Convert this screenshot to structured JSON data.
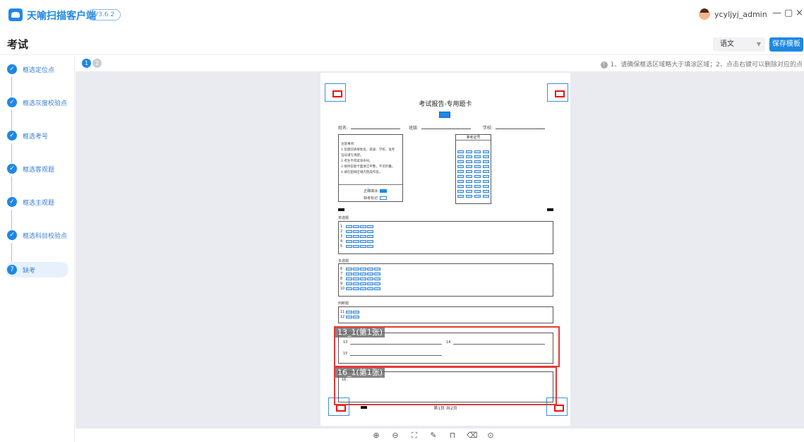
{
  "app": {
    "name": "天喻扫描客户端",
    "version": "V3.6.2"
  },
  "user": {
    "name": "ycyljyj_admin"
  },
  "window": {
    "minimize": "—",
    "maximize": "▢",
    "close": "×"
  },
  "page": {
    "title": "考试",
    "subject_select": "语文",
    "save_button": "保存模板"
  },
  "steps": [
    {
      "label": "框选定位点",
      "state": "done",
      "icon": "✓"
    },
    {
      "label": "框选灰度校验点",
      "state": "done",
      "icon": "✓"
    },
    {
      "label": "框选考号",
      "state": "done",
      "icon": "✓"
    },
    {
      "label": "框选客观题",
      "state": "done",
      "icon": "✓"
    },
    {
      "label": "框选主观题",
      "state": "done",
      "icon": "✓"
    },
    {
      "label": "框选科目校验点",
      "state": "done",
      "icon": "✓"
    },
    {
      "label": "缺考",
      "state": "active",
      "icon": "7"
    }
  ],
  "pages": [
    "1",
    "2"
  ],
  "hint": "1、请确保框选区域略大于填涂区域；2、点击右键可以删除对应的点",
  "sheet": {
    "title": "考试报告-专用题卡",
    "fields": [
      "姓名:",
      "班级:",
      "学校:"
    ],
    "notes_lines": [
      "注意事项:",
      "1.答题前请将姓名、班级、学校、准考",
      "证号填写清楚。",
      "2.考生不得遮涂条码。",
      "3.保持答题卡面清洁平整，不可折叠。",
      "4.请在题目区域内完成作答。"
    ],
    "fill_example": "正确填涂",
    "absent_mark": "缺考标记",
    "id_header": "准考证号",
    "section_single": "单选题",
    "section_multi": "多选题",
    "section_judge": "判断题",
    "q_nums_single": [
      "1",
      "2",
      "3",
      "4",
      "5"
    ],
    "q_nums_multi": [
      "6",
      "7",
      "8",
      "9",
      "10"
    ],
    "q_nums_judge": [
      "11",
      "12"
    ],
    "fill_q13": "13",
    "fill_q14": "14",
    "fill_q15": "15",
    "fill_q16": "16 .",
    "region_1": "13_1(第1张)",
    "region_2": "16_1(第1张)",
    "footer": "第1页 共2页"
  },
  "toolbar": [
    {
      "name": "zoom-in-icon",
      "glyph": "⊕"
    },
    {
      "name": "zoom-out-icon",
      "glyph": "⊖"
    },
    {
      "name": "fit-screen-icon",
      "glyph": "⛶"
    },
    {
      "name": "edit-region-icon",
      "glyph": "✎"
    },
    {
      "name": "select-region-icon",
      "glyph": "⊓"
    },
    {
      "name": "eraser-icon",
      "glyph": "⌫"
    },
    {
      "name": "target-icon",
      "glyph": "⊙"
    }
  ],
  "colors": {
    "accent": "#1e88e5",
    "region": "#e53935",
    "canvas": "#e9ebf0"
  }
}
